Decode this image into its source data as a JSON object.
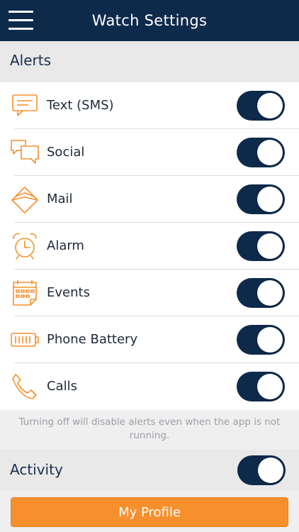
{
  "header": {
    "title": "Watch Settings"
  },
  "alerts_section": {
    "title": "Alerts"
  },
  "alert_items": [
    {
      "label": "Text (SMS)",
      "icon": "message-icon",
      "enabled": true
    },
    {
      "label": "Social",
      "icon": "chat-bubbles-icon",
      "enabled": true
    },
    {
      "label": "Mail",
      "icon": "envelope-icon",
      "enabled": true
    },
    {
      "label": "Alarm",
      "icon": "alarm-clock-icon",
      "enabled": true
    },
    {
      "label": "Events",
      "icon": "calendar-icon",
      "enabled": true
    },
    {
      "label": "Phone Battery",
      "icon": "battery-icon",
      "enabled": true
    },
    {
      "label": "Calls",
      "icon": "phone-icon",
      "enabled": true
    }
  ],
  "footnote": "Turning off will disable alerts even when the app is not running.",
  "activity_section": {
    "title": "Activity",
    "enabled": true
  },
  "profile_button": {
    "label": "My Profile"
  },
  "colors": {
    "header_bg": "#0e2a4b",
    "toggle_on": "#0e2a4b",
    "icon_accent": "#f5902d",
    "button_bg": "#f5902d"
  }
}
